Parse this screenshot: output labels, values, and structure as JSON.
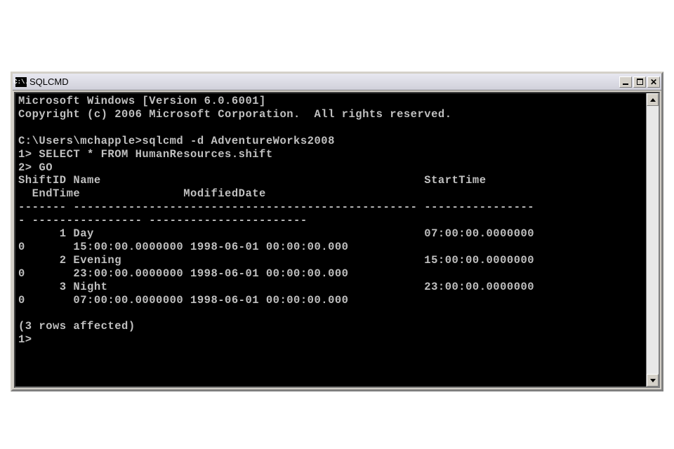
{
  "titlebar": {
    "icon_text": "C:\\.",
    "title": "SQLCMD"
  },
  "terminal": {
    "line1": "Microsoft Windows [Version 6.0.6001]",
    "line2": "Copyright (c) 2006 Microsoft Corporation.  All rights reserved.",
    "line3": "",
    "line4": "C:\\Users\\mchapple>sqlcmd -d AdventureWorks2008",
    "line5": "1> SELECT * FROM HumanResources.shift",
    "line6": "2> GO",
    "line7": "ShiftID Name                                               StartTime",
    "line8": "  EndTime               ModifiedDate",
    "line9": "------- -------------------------------------------------- ----------------",
    "line10": "- ---------------- -----------------------",
    "line11": "      1 Day                                                07:00:00.0000000",
    "line12": "0       15:00:00.0000000 1998-06-01 00:00:00.000",
    "line13": "      2 Evening                                            15:00:00.0000000",
    "line14": "0       23:00:00.0000000 1998-06-01 00:00:00.000",
    "line15": "      3 Night                                              23:00:00.0000000",
    "line16": "0       07:00:00.0000000 1998-06-01 00:00:00.000",
    "line17": "",
    "line18": "(3 rows affected)",
    "line19": "1>"
  }
}
